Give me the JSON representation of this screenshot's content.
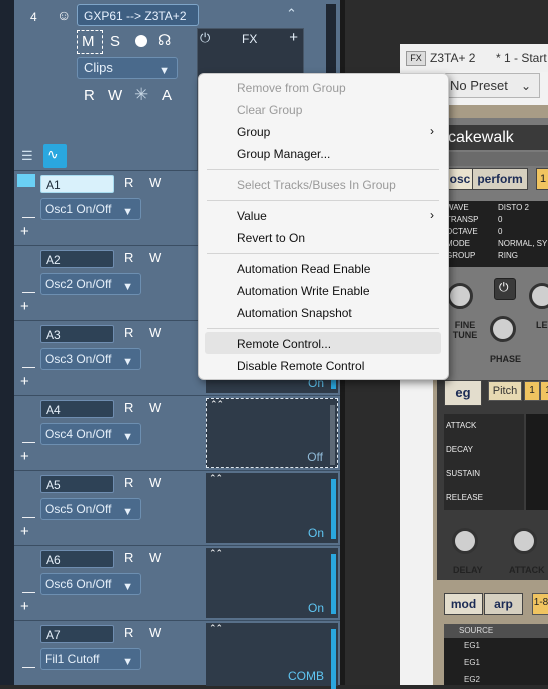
{
  "track": {
    "number": "4",
    "name": "GXP61 --> Z3TA+2",
    "buttons": {
      "mute": "M",
      "solo": "S",
      "read": "R",
      "write": "W",
      "input": "A"
    },
    "clips_label": "Clips",
    "fx_label": "FX",
    "fx_add": "+"
  },
  "lanes": [
    {
      "name": "A1",
      "param": "Osc1 On/Off",
      "value": "",
      "R": "R",
      "W": "W"
    },
    {
      "name": "A2",
      "param": "Osc2 On/Off",
      "value": "",
      "R": "R",
      "W": "W"
    },
    {
      "name": "A3",
      "param": "Osc3 On/Off",
      "value": "On",
      "R": "R",
      "W": "W"
    },
    {
      "name": "A4",
      "param": "Osc4 On/Off",
      "value": "Off",
      "R": "R",
      "W": "W"
    },
    {
      "name": "A5",
      "param": "Osc5 On/Off",
      "value": "On",
      "R": "R",
      "W": "W"
    },
    {
      "name": "A6",
      "param": "Osc6 On/Off",
      "value": "On",
      "R": "R",
      "W": "W"
    },
    {
      "name": "A7",
      "param": "Fil1 Cutoff",
      "value": "COMB",
      "R": "R",
      "W": "W"
    }
  ],
  "lane_controls": {
    "minus": "—",
    "plus": "+"
  },
  "menu": {
    "remove_from_group": "Remove from Group",
    "clear_group": "Clear Group",
    "group": "Group",
    "group_manager": "Group Manager...",
    "select_tracks": "Select Tracks/Buses In Group",
    "value": "Value",
    "revert": "Revert to On",
    "read_enable": "Automation Read Enable",
    "write_enable": "Automation Write Enable",
    "snapshot": "Automation Snapshot",
    "remote_control": "Remote Control...",
    "disable_remote": "Disable Remote Control"
  },
  "plugin": {
    "fx_tag": "FX",
    "title": "Z3TA+ 2",
    "title_extra": "* 1 - Start",
    "preset": "No Preset",
    "brand": "cakewalk",
    "tab_osc": "osc",
    "tab_perform": "perform",
    "tab_num": "1",
    "params": [
      {
        "label": "WAVE",
        "value": "DISTO 2"
      },
      {
        "label": "TRANSP",
        "value": "0"
      },
      {
        "label": "OCTAVE",
        "value": "0"
      },
      {
        "label": "MODE",
        "value": "NORMAL, SYN"
      },
      {
        "label": "GROUP",
        "value": "RING"
      }
    ],
    "knob_fine": "FINE TUNE",
    "knob_phase": "PHASE",
    "knob_lev": "LEV",
    "eg_tab": "eg",
    "pitch": "Pitch",
    "one_a": "1",
    "one_b": "1",
    "eg_rows": [
      "ATTACK",
      "DECAY",
      "SUSTAIN",
      "RELEASE"
    ],
    "delay": "DELAY",
    "attack": "ATTACK",
    "mod_tab": "mod",
    "arp_tab": "arp",
    "tab_1b": "1-8",
    "source_header": "SOURCE",
    "sources": [
      "EG1",
      "EG1",
      "EG2"
    ]
  },
  "colors": {
    "track_bg": "#58708a",
    "accent": "#2aa7df",
    "menu_bg": "#f5f5f5"
  }
}
